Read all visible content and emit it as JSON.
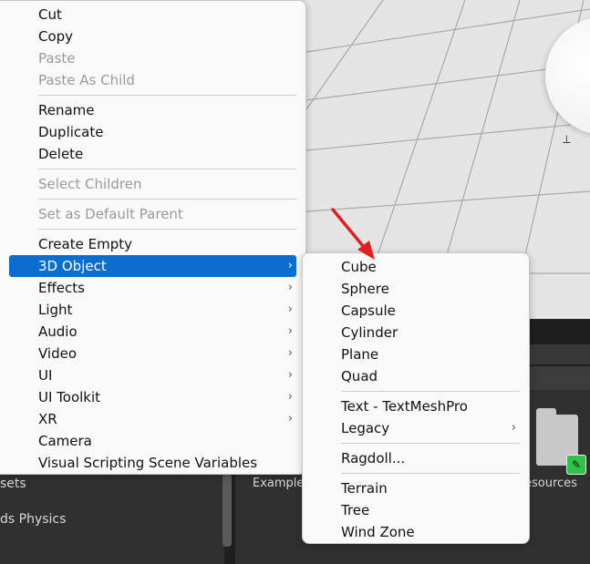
{
  "context_menu": {
    "items": [
      {
        "label": "Cut",
        "enabled": true
      },
      {
        "label": "Copy",
        "enabled": true
      },
      {
        "label": "Paste",
        "enabled": false
      },
      {
        "label": "Paste As Child",
        "enabled": false
      },
      {
        "label": "Rename",
        "enabled": true
      },
      {
        "label": "Duplicate",
        "enabled": true
      },
      {
        "label": "Delete",
        "enabled": true
      },
      {
        "label": "Select Children",
        "enabled": false
      },
      {
        "label": "Set as Default Parent",
        "enabled": false
      },
      {
        "label": "Create Empty",
        "enabled": true
      },
      {
        "label": "3D Object",
        "enabled": true,
        "submenu": true,
        "highlighted": true
      },
      {
        "label": "Effects",
        "enabled": true,
        "submenu": true
      },
      {
        "label": "Light",
        "enabled": true,
        "submenu": true
      },
      {
        "label": "Audio",
        "enabled": true,
        "submenu": true
      },
      {
        "label": "Video",
        "enabled": true,
        "submenu": true
      },
      {
        "label": "UI",
        "enabled": true,
        "submenu": true
      },
      {
        "label": "UI Toolkit",
        "enabled": true,
        "submenu": true
      },
      {
        "label": "XR",
        "enabled": true,
        "submenu": true
      },
      {
        "label": "Camera",
        "enabled": true
      },
      {
        "label": "Visual Scripting Scene Variables",
        "enabled": true
      }
    ],
    "submenu_glyph": "›"
  },
  "submenu_3d": {
    "items": [
      {
        "label": "Cube"
      },
      {
        "label": "Sphere"
      },
      {
        "label": "Capsule"
      },
      {
        "label": "Cylinder"
      },
      {
        "label": "Plane"
      },
      {
        "label": "Quad"
      },
      {
        "label": "Text - TextMeshPro"
      },
      {
        "label": "Legacy",
        "submenu": true
      },
      {
        "label": "Ragdoll..."
      },
      {
        "label": "Terrain"
      },
      {
        "label": "Tree"
      },
      {
        "label": "Wind Zone"
      }
    ]
  },
  "background": {
    "left_panel_items": [
      "sets",
      "ds Physics"
    ],
    "asset_labels": [
      "Example",
      "esources"
    ]
  },
  "colors": {
    "highlight": "#0a6ed1",
    "annotation_arrow": "#e02020",
    "scene_background": "#e4e4e4",
    "editor_panel": "#303030"
  },
  "icons": {
    "annotation": "red-arrow-icon",
    "folder": "folder-icon",
    "badge": "edit-badge-icon"
  }
}
